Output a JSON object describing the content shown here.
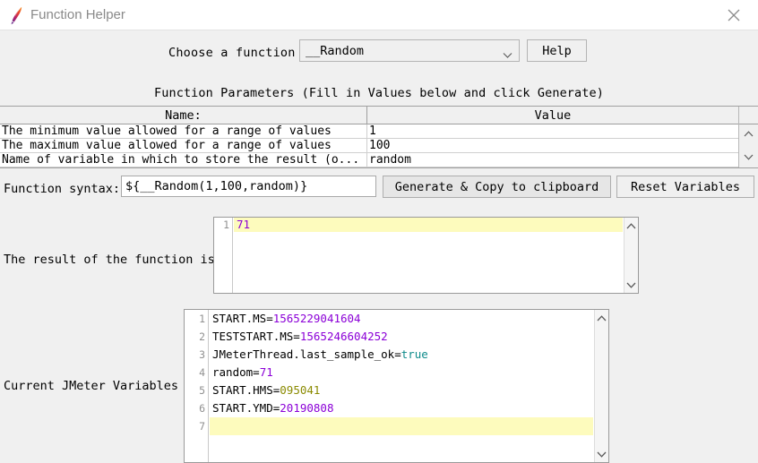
{
  "window": {
    "title": "Function Helper",
    "icon": "jmeter-feather-icon",
    "close_label": "✕"
  },
  "toolbar": {
    "choose_label": "Choose a function",
    "selected_function": "__Random",
    "help_label": "Help"
  },
  "parameters": {
    "section_title": "Function Parameters (Fill in Values below and click Generate)",
    "columns": [
      "Name:",
      "Value"
    ],
    "rows": [
      {
        "name": "The minimum value allowed for a range of values",
        "value": "1"
      },
      {
        "name": "The maximum value allowed for a range of values",
        "value": "100"
      },
      {
        "name": "Name of variable in which to store the result (o...",
        "value": "random"
      }
    ]
  },
  "syntax": {
    "label": "Function syntax:",
    "value": "${__Random(1,100,random)}",
    "generate_label": "Generate & Copy to clipboard",
    "reset_label": "Reset Variables"
  },
  "result": {
    "label": "The result of the function is",
    "line_numbers": [
      "1"
    ],
    "lines": [
      {
        "text": "71",
        "type": "num",
        "highlighted": true
      }
    ]
  },
  "variables": {
    "label": "Current JMeter Variables",
    "line_numbers": [
      "1",
      "2",
      "3",
      "4",
      "5",
      "6",
      "7"
    ],
    "lines": [
      {
        "key": "START.MS=",
        "value": "1565229041604",
        "type": "num",
        "highlighted": false
      },
      {
        "key": "TESTSTART.MS=",
        "value": "1565246604252",
        "type": "num",
        "highlighted": false
      },
      {
        "key": "JMeterThread.last_sample_ok=",
        "value": "true",
        "type": "bool",
        "highlighted": false
      },
      {
        "key": "random=",
        "value": "71",
        "type": "num",
        "highlighted": false
      },
      {
        "key": "START.HMS=",
        "value": "095041",
        "type": "oct",
        "highlighted": false
      },
      {
        "key": "START.YMD=",
        "value": "20190808",
        "type": "num",
        "highlighted": false
      },
      {
        "key": "",
        "value": "",
        "type": "num",
        "highlighted": true
      }
    ]
  },
  "colors": {
    "number": "#8b00d7",
    "boolean": "#0f8b8b",
    "octal": "#8a8a00",
    "highlight": "#fdfbbd",
    "window_bg": "#f0f0f0",
    "title_text": "#8a8a8a"
  }
}
